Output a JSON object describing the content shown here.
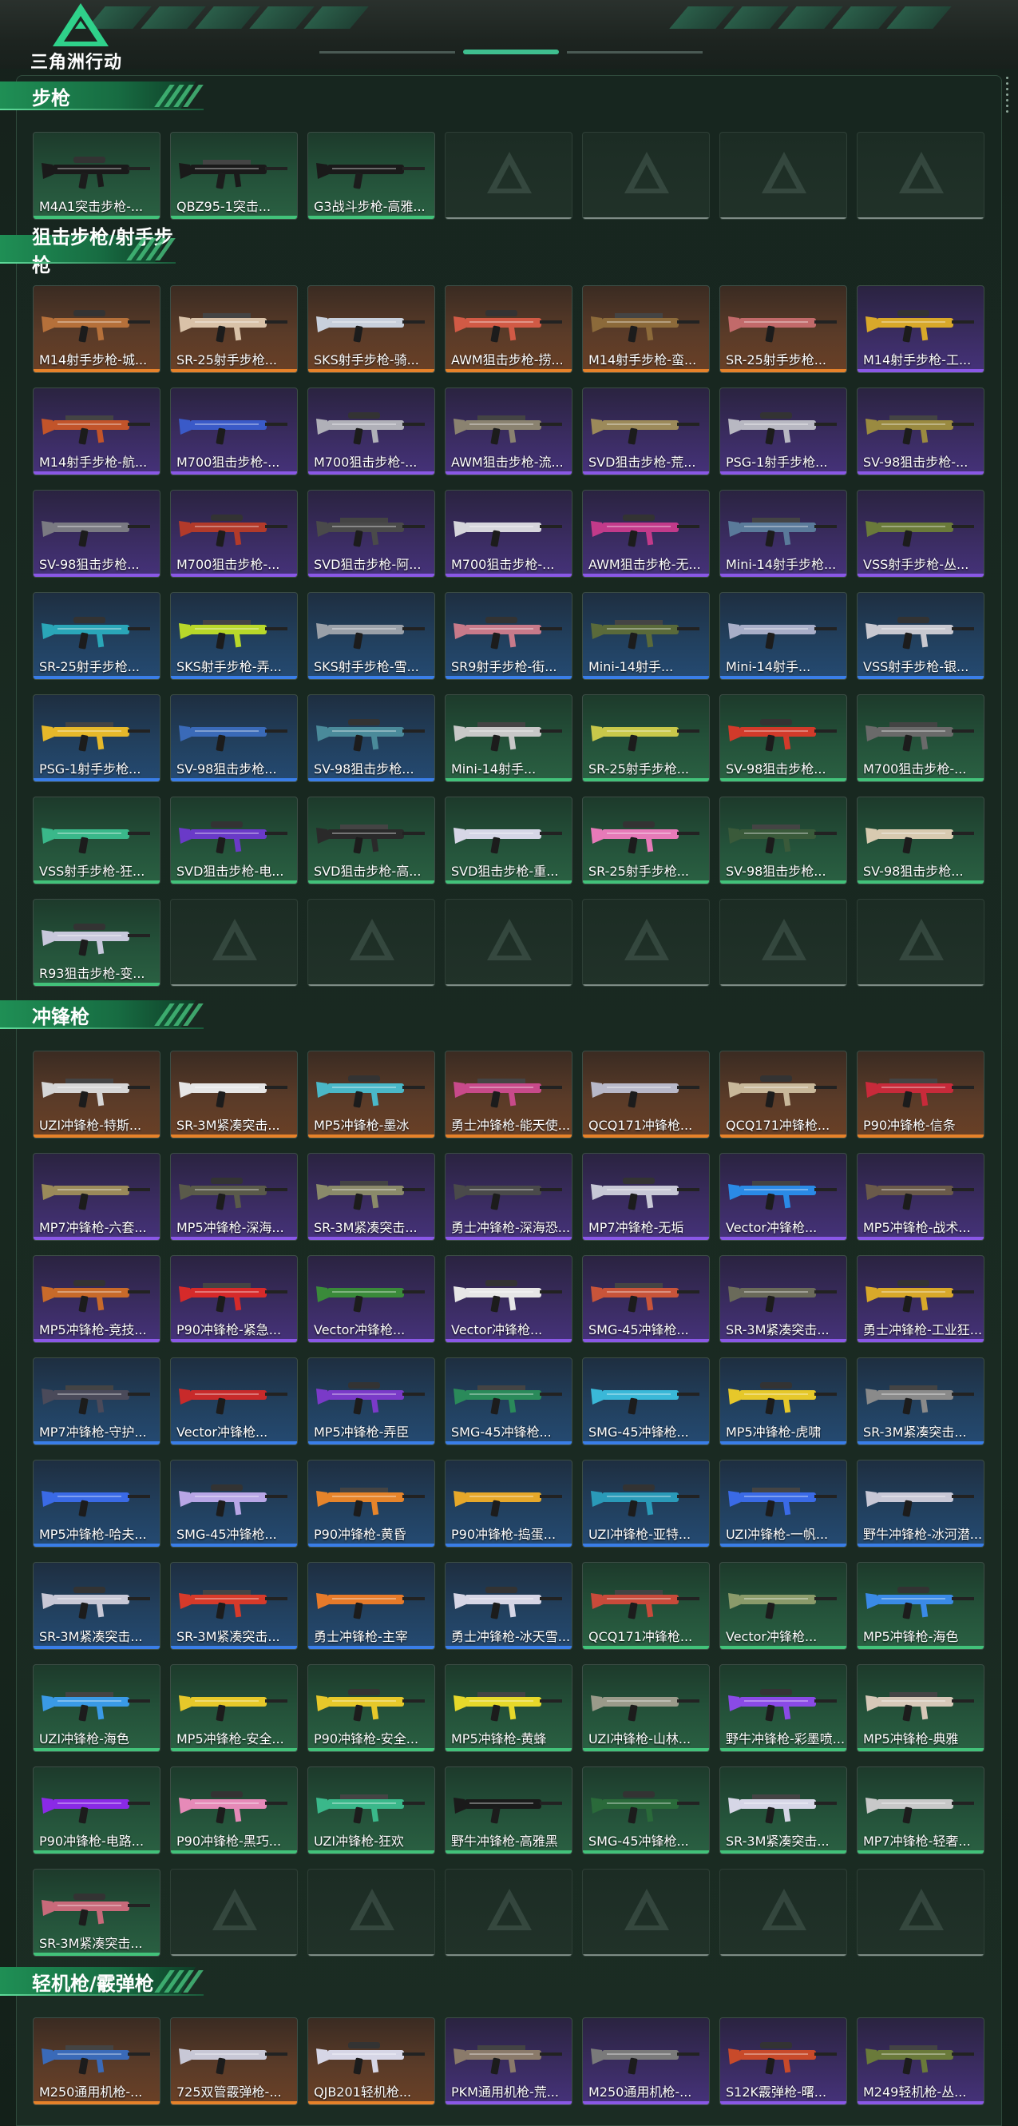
{
  "app": {
    "title": "三角洲行动"
  },
  "colors": {
    "orange": "#e6822a",
    "purple": "#8a58e6",
    "blue": "#3a7ee8",
    "green": "#42c27a",
    "accent": "#3fbf8f"
  },
  "categories": [
    {
      "title": "步枪",
      "rows": [
        [
          {
            "label": "M4A1突击步枪-...",
            "rarity": "green",
            "gun": "#1a1a1a"
          },
          {
            "label": "QBZ95-1突击...",
            "rarity": "green",
            "gun": "#1a1a1a"
          },
          {
            "label": "G3战斗步枪-高雅...",
            "rarity": "green",
            "gun": "#1a1a1a"
          },
          {
            "label": "",
            "rarity": "empty"
          },
          {
            "label": "",
            "rarity": "empty"
          },
          {
            "label": "",
            "rarity": "empty"
          },
          {
            "label": "",
            "rarity": "empty"
          }
        ]
      ]
    },
    {
      "title": "狙击步枪/射手步枪",
      "rows": [
        [
          {
            "label": "M14射手步枪-城...",
            "rarity": "orange",
            "gun": "#b5703a"
          },
          {
            "label": "SR-25射手步枪...",
            "rarity": "orange",
            "gun": "#d9c2a8"
          },
          {
            "label": "SKS射手步枪-骑...",
            "rarity": "orange",
            "gun": "#c8d0dc"
          },
          {
            "label": "AWM狙击步枪-捞...",
            "rarity": "orange",
            "gun": "#d15a45"
          },
          {
            "label": "M14射手步枪-蛮...",
            "rarity": "orange",
            "gun": "#8c6a3a"
          },
          {
            "label": "SR-25射手步枪...",
            "rarity": "orange",
            "gun": "#c26a6a"
          },
          {
            "label": "M14射手步枪-工...",
            "rarity": "purple",
            "gun": "#d8a82a"
          }
        ],
        [
          {
            "label": "M14射手步枪-航...",
            "rarity": "purple",
            "gun": "#c2542a"
          },
          {
            "label": "M700狙击步枪-...",
            "rarity": "purple",
            "gun": "#3a5ac8"
          },
          {
            "label": "M700狙击步枪-...",
            "rarity": "purple",
            "gun": "#b0b0b8"
          },
          {
            "label": "AWM狙击步枪-流...",
            "rarity": "purple",
            "gun": "#8a8270"
          },
          {
            "label": "SVD狙击步枪-荒...",
            "rarity": "purple",
            "gun": "#9c8a5a"
          },
          {
            "label": "PSG-1射手步枪...",
            "rarity": "purple",
            "gun": "#b8b8c2"
          },
          {
            "label": "SV-98狙击步枪-...",
            "rarity": "purple",
            "gun": "#9a8a40"
          }
        ],
        [
          {
            "label": "SV-98狙击步枪...",
            "rarity": "purple",
            "gun": "#7a7a82"
          },
          {
            "label": "M700狙击步枪-...",
            "rarity": "purple",
            "gun": "#b23a2a"
          },
          {
            "label": "SVD狙击步枪-阿...",
            "rarity": "purple",
            "gun": "#4a4a4a"
          },
          {
            "label": "M700狙击步枪-...",
            "rarity": "purple",
            "gun": "#d6d6dc"
          },
          {
            "label": "AWM狙击步枪-无...",
            "rarity": "purple",
            "gun": "#c23a8a"
          },
          {
            "label": "Mini-14射手步枪...",
            "rarity": "purple",
            "gun": "#5a7a9a"
          },
          {
            "label": "VSS射手步枪-丛...",
            "rarity": "purple",
            "gun": "#6a7a3a"
          }
        ],
        [
          {
            "label": "SR-25射手步枪...",
            "rarity": "blue",
            "gun": "#2aa6b8"
          },
          {
            "label": "SKS射手步枪-弄...",
            "rarity": "blue",
            "gun": "#b8d82a"
          },
          {
            "label": "SKS射手步枪-雪...",
            "rarity": "blue",
            "gun": "#9aa0a8"
          },
          {
            "label": "SR9射手步枪-街...",
            "rarity": "blue",
            "gun": "#c87a8a"
          },
          {
            "label": "Mini-14射手...",
            "rarity": "blue",
            "gun": "#5a6a3a"
          },
          {
            "label": "Mini-14射手...",
            "rarity": "blue",
            "gun": "#a8aec8"
          },
          {
            "label": "VSS射手步枪-银...",
            "rarity": "blue",
            "gun": "#c8c8d0"
          }
        ],
        [
          {
            "label": "PSG-1射手步枪...",
            "rarity": "blue",
            "gun": "#e6b82a"
          },
          {
            "label": "SV-98狙击步枪...",
            "rarity": "blue",
            "gun": "#3a6ab8"
          },
          {
            "label": "SV-98狙击步枪...",
            "rarity": "blue",
            "gun": "#4a8a9a"
          },
          {
            "label": "Mini-14射手...",
            "rarity": "green",
            "gun": "#c8c8c8"
          },
          {
            "label": "SR-25射手步枪...",
            "rarity": "green",
            "gun": "#c8c84a"
          },
          {
            "label": "SV-98狙击步枪...",
            "rarity": "green",
            "gun": "#d23a2a"
          },
          {
            "label": "M700狙击步枪-...",
            "rarity": "green",
            "gun": "#6a6a6a"
          }
        ],
        [
          {
            "label": "VSS射手步枪-狂...",
            "rarity": "green",
            "gun": "#3ab88a"
          },
          {
            "label": "SVD狙击步枪-电...",
            "rarity": "green",
            "gun": "#6a3ac8"
          },
          {
            "label": "SVD狙击步枪-高...",
            "rarity": "green",
            "gun": "#2a2a2a"
          },
          {
            "label": "SVD狙击步枪-重...",
            "rarity": "green",
            "gun": "#d6d6e6"
          },
          {
            "label": "SR-25射手步枪...",
            "rarity": "green",
            "gun": "#e67ab8"
          },
          {
            "label": "SV-98狙击步枪...",
            "rarity": "green",
            "gun": "#3a5a3a"
          },
          {
            "label": "SV-98狙击步枪...",
            "rarity": "green",
            "gun": "#d8cab0"
          }
        ],
        [
          {
            "label": "R93狙击步枪-变...",
            "rarity": "green",
            "gun": "#c8c8dc"
          },
          {
            "label": "",
            "rarity": "empty"
          },
          {
            "label": "",
            "rarity": "empty"
          },
          {
            "label": "",
            "rarity": "empty"
          },
          {
            "label": "",
            "rarity": "empty"
          },
          {
            "label": "",
            "rarity": "empty"
          },
          {
            "label": "",
            "rarity": "empty"
          }
        ]
      ]
    },
    {
      "title": "冲锋枪",
      "rows": [
        [
          {
            "label": "UZI冲锋枪-特斯...",
            "rarity": "orange",
            "gun": "#d6d6d6"
          },
          {
            "label": "SR-3M紧凑突击...",
            "rarity": "orange",
            "gun": "#e6e6e6"
          },
          {
            "label": "MP5冲锋枪-墨冰",
            "rarity": "orange",
            "gun": "#4ab8c8"
          },
          {
            "label": "勇士冲锋枪-能天使...",
            "rarity": "orange",
            "gun": "#c84a8a"
          },
          {
            "label": "QCQ171冲锋枪...",
            "rarity": "orange",
            "gun": "#b8b8c8"
          },
          {
            "label": "QCQ171冲锋枪...",
            "rarity": "orange",
            "gun": "#c8b89a"
          },
          {
            "label": "P90冲锋枪-信条",
            "rarity": "orange",
            "gun": "#c82a3a"
          }
        ],
        [
          {
            "label": "MP7冲锋枪-六套...",
            "rarity": "purple",
            "gun": "#9a8a5a"
          },
          {
            "label": "MP5冲锋枪-深海...",
            "rarity": "purple",
            "gun": "#5a5a4a"
          },
          {
            "label": "SR-3M紧凑突击...",
            "rarity": "purple",
            "gun": "#8a8a6a"
          },
          {
            "label": "勇士冲锋枪-深海恐...",
            "rarity": "purple",
            "gun": "#4a4a4a"
          },
          {
            "label": "MP7冲锋枪-无垢",
            "rarity": "purple",
            "gun": "#c8c8d6"
          },
          {
            "label": "Vector冲锋枪...",
            "rarity": "purple",
            "gun": "#2a8ae6"
          },
          {
            "label": "MP5冲锋枪-战术...",
            "rarity": "purple",
            "gun": "#6a5a4a"
          }
        ],
        [
          {
            "label": "MP5冲锋枪-竞技...",
            "rarity": "purple",
            "gun": "#c86a2a"
          },
          {
            "label": "P90冲锋枪-紧急...",
            "rarity": "purple",
            "gun": "#d62a2a"
          },
          {
            "label": "Vector冲锋枪...",
            "rarity": "purple",
            "gun": "#3a8a3a"
          },
          {
            "label": "Vector冲锋枪...",
            "rarity": "purple",
            "gun": "#e6e6e6"
          },
          {
            "label": "SMG-45冲锋枪...",
            "rarity": "purple",
            "gun": "#c8543a"
          },
          {
            "label": "SR-3M紧凑突击...",
            "rarity": "purple",
            "gun": "#6a6a5a"
          },
          {
            "label": "勇士冲锋枪-工业狂...",
            "rarity": "purple",
            "gun": "#d8a82a"
          }
        ],
        [
          {
            "label": "MP7冲锋枪-守护...",
            "rarity": "blue",
            "gun": "#4a4a5a"
          },
          {
            "label": "Vector冲锋枪...",
            "rarity": "blue",
            "gun": "#c82a2a"
          },
          {
            "label": "MP5冲锋枪-弄臣",
            "rarity": "blue",
            "gun": "#7a3ac8"
          },
          {
            "label": "SMG-45冲锋枪...",
            "rarity": "blue",
            "gun": "#2a8a5a"
          },
          {
            "label": "SMG-45冲锋枪...",
            "rarity": "blue",
            "gun": "#3ab8d8"
          },
          {
            "label": "MP5冲锋枪-虎啸",
            "rarity": "blue",
            "gun": "#e6c82a"
          },
          {
            "label": "SR-3M紧凑突击...",
            "rarity": "blue",
            "gun": "#8a8a8a"
          }
        ],
        [
          {
            "label": "MP5冲锋枪-哈夫...",
            "rarity": "blue",
            "gun": "#3a6ae6"
          },
          {
            "label": "SMG-45冲锋枪...",
            "rarity": "blue",
            "gun": "#b8a6e6"
          },
          {
            "label": "P90冲锋枪-黄昏",
            "rarity": "blue",
            "gun": "#e6842a"
          },
          {
            "label": "P90冲锋枪-捣蛋...",
            "rarity": "blue",
            "gun": "#e6a82a"
          },
          {
            "label": "UZI冲锋枪-亚特...",
            "rarity": "blue",
            "gun": "#2a9ab8"
          },
          {
            "label": "UZI冲锋枪-一帆...",
            "rarity": "blue",
            "gun": "#3a6ae6"
          },
          {
            "label": "野牛冲锋枪-冰河潜...",
            "rarity": "blue",
            "gun": "#c8c8d6"
          }
        ],
        [
          {
            "label": "SR-3M紧凑突击...",
            "rarity": "blue",
            "gun": "#c8c8d6"
          },
          {
            "label": "SR-3M紧凑突击...",
            "rarity": "blue",
            "gun": "#d63a2a"
          },
          {
            "label": "勇士冲锋枪-主宰",
            "rarity": "blue",
            "gun": "#e67a2a"
          },
          {
            "label": "勇士冲锋枪-冰天雪...",
            "rarity": "blue",
            "gun": "#d6d6e6"
          },
          {
            "label": "QCQ171冲锋枪...",
            "rarity": "green",
            "gun": "#c84a3a"
          },
          {
            "label": "Vector冲锋枪...",
            "rarity": "green",
            "gun": "#8a9a6a"
          },
          {
            "label": "MP5冲锋枪-海色",
            "rarity": "green",
            "gun": "#3a8ae6"
          }
        ],
        [
          {
            "label": "UZI冲锋枪-海色",
            "rarity": "green",
            "gun": "#3a9ae6"
          },
          {
            "label": "MP5冲锋枪-安全...",
            "rarity": "green",
            "gun": "#e6c82a"
          },
          {
            "label": "P90冲锋枪-安全...",
            "rarity": "green",
            "gun": "#e6c82a"
          },
          {
            "label": "MP5冲锋枪-黄蜂",
            "rarity": "green",
            "gun": "#e6d82a"
          },
          {
            "label": "UZI冲锋枪-山林...",
            "rarity": "green",
            "gun": "#9a9a8a"
          },
          {
            "label": "野牛冲锋枪-彩墨喷...",
            "rarity": "green",
            "gun": "#8a4ae6"
          },
          {
            "label": "MP5冲锋枪-典雅",
            "rarity": "green",
            "gun": "#d6c8b8"
          }
        ],
        [
          {
            "label": "P90冲锋枪-电路...",
            "rarity": "green",
            "gun": "#8a2ae6"
          },
          {
            "label": "P90冲锋枪-黑巧...",
            "rarity": "green",
            "gun": "#e68ab8"
          },
          {
            "label": "UZI冲锋枪-狂欢",
            "rarity": "green",
            "gun": "#3ab88a"
          },
          {
            "label": "野牛冲锋枪-高雅黑",
            "rarity": "green",
            "gun": "#1a1a1a"
          },
          {
            "label": "SMG-45冲锋枪...",
            "rarity": "green",
            "gun": "#2a6a3a"
          },
          {
            "label": "SR-3M紧凑突击...",
            "rarity": "green",
            "gun": "#d6d6e6"
          },
          {
            "label": "MP7冲锋枪-轻奢...",
            "rarity": "green",
            "gun": "#c8c8c8"
          }
        ],
        [
          {
            "label": "SR-3M紧凑突击...",
            "rarity": "green",
            "gun": "#c86a7a"
          },
          {
            "label": "",
            "rarity": "empty"
          },
          {
            "label": "",
            "rarity": "empty"
          },
          {
            "label": "",
            "rarity": "empty"
          },
          {
            "label": "",
            "rarity": "empty"
          },
          {
            "label": "",
            "rarity": "empty"
          },
          {
            "label": "",
            "rarity": "empty"
          }
        ]
      ]
    },
    {
      "title": "轻机枪/霰弹枪",
      "rows": [
        [
          {
            "label": "M250通用机枪-...",
            "rarity": "orange",
            "gun": "#3a6ab8"
          },
          {
            "label": "725双管霰弹枪-...",
            "rarity": "orange",
            "gun": "#c8c8d6"
          },
          {
            "label": "QJB201轻机枪...",
            "rarity": "orange",
            "gun": "#d6d6e6"
          },
          {
            "label": "PKM通用机枪-荒...",
            "rarity": "purple",
            "gun": "#8a7a6a"
          },
          {
            "label": "M250通用机枪-...",
            "rarity": "purple",
            "gun": "#7a7a7a"
          },
          {
            "label": "S12K霰弹枪-曙...",
            "rarity": "purple",
            "gun": "#c84a2a"
          },
          {
            "label": "M249轻机枪-丛...",
            "rarity": "purple",
            "gun": "#6a7a3a"
          }
        ]
      ]
    }
  ]
}
